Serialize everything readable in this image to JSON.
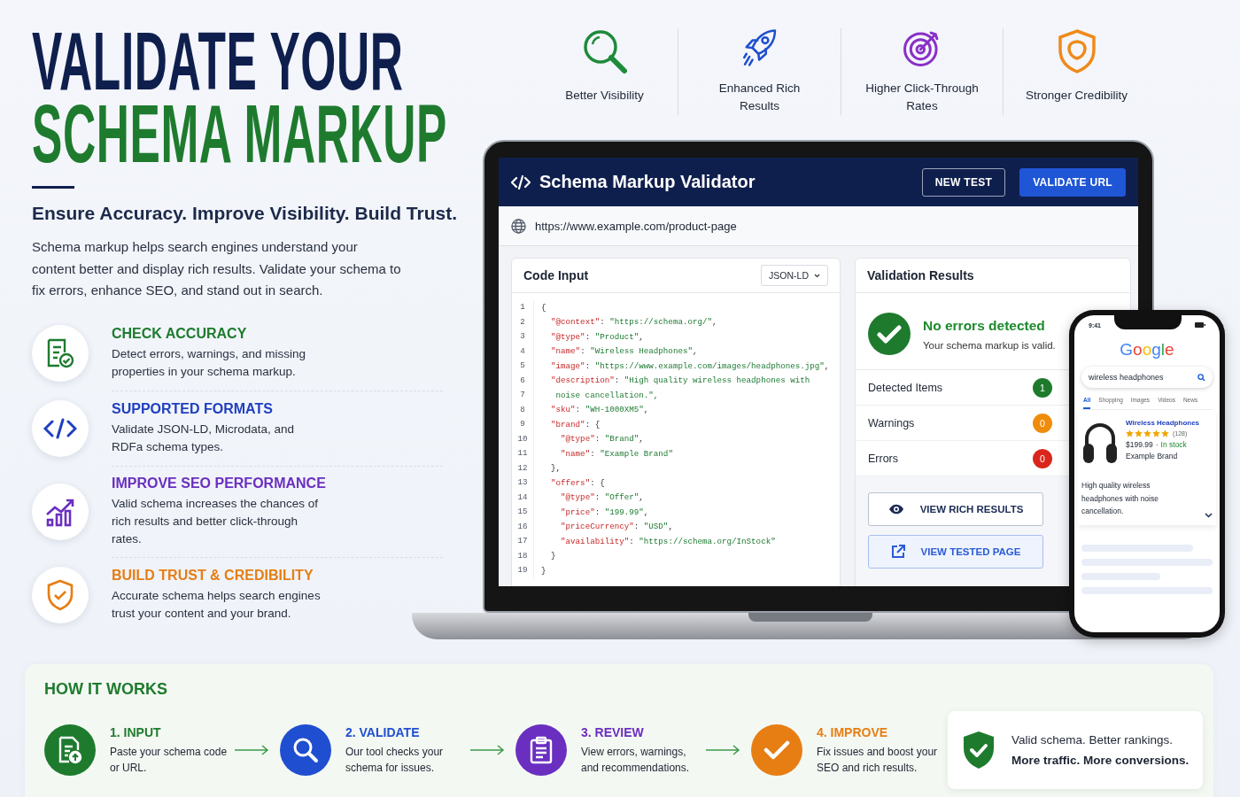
{
  "headline": {
    "line_1": "VALIDATE YOUR",
    "line_2": "SCHEMA MARKUP"
  },
  "tagline": "Ensure Accuracy. Improve Visibility. Build Trust.",
  "intro": "Schema markup helps search engines understand your content better and display rich results. Validate your schema to fix errors, enhance SEO, and stand out in search.",
  "features": [
    {
      "kind": "checklist",
      "title": "CHECK ACCURACY",
      "text": "Detect errors, warnings, and missing properties in your schema markup.",
      "color": "#1e7b2e"
    },
    {
      "kind": "code",
      "title": "SUPPORTED FORMATS",
      "text": "Validate JSON-LD, Microdata, and RDFa schema types.",
      "color": "#1f3fbf"
    },
    {
      "kind": "chart",
      "title": "IMPROVE SEO PERFORMANCE",
      "text": "Valid schema increases the chances of rich results and better click-through rates.",
      "color": "#6a2fc0"
    },
    {
      "kind": "shield",
      "title": "BUILD TRUST & CREDIBILITY",
      "text": "Accurate schema helps search engines trust your content and your brand.",
      "color": "#e67e14"
    }
  ],
  "benefits": [
    {
      "kind": "magnifier",
      "label": "Better Visibility"
    },
    {
      "kind": "rocket",
      "label": "Enhanced Rich Results"
    },
    {
      "kind": "target",
      "label": "Higher Click-Through Rates"
    },
    {
      "kind": "shield",
      "label": "Stronger Credibility"
    }
  ],
  "validator": {
    "title": "Schema Markup Validator",
    "buttons": [
      {
        "label": "NEW TEST",
        "kind": "outline"
      },
      {
        "label": "VALIDATE URL",
        "kind": "primary"
      }
    ],
    "url": "https://www.example.com/product-page",
    "code_panel": {
      "title": "Code Input",
      "format": "JSON-LD",
      "lines": [
        {
          "number": "1",
          "kind": "code",
          "text": "{"
        },
        {
          "number": "2",
          "kind": "code",
          "text": "  \"@context\": \"https://schema.org/\","
        },
        {
          "number": "3",
          "kind": "code",
          "text": "  \"@type\": \"Product\","
        },
        {
          "number": "4",
          "kind": "code",
          "text": "  \"name\": \"Wireless Headphones\","
        },
        {
          "number": "5",
          "kind": "code",
          "text": "  \"image\": \"https://www.example.com/images/headphones.jpg\","
        },
        {
          "number": "6",
          "kind": "code",
          "text": "  \"description\": \"High quality wireless headphones with"
        },
        {
          "number": "7",
          "kind": "continuation",
          "text": "   noise cancellation.\","
        },
        {
          "number": "8",
          "kind": "code",
          "text": "  \"sku\": \"WH-1000XM5\","
        },
        {
          "number": "9",
          "kind": "code",
          "text": "  \"brand\": {"
        },
        {
          "number": "10",
          "kind": "code",
          "text": "    \"@type\": \"Brand\","
        },
        {
          "number": "11",
          "kind": "code",
          "text": "    \"name\": \"Example Brand\""
        },
        {
          "number": "12",
          "kind": "code",
          "text": "  },"
        },
        {
          "number": "13",
          "kind": "code",
          "text": "  \"offers\": {"
        },
        {
          "number": "14",
          "kind": "code",
          "text": "    \"@type\": \"Offer\","
        },
        {
          "number": "15",
          "kind": "code",
          "text": "    \"price\": \"199.99\","
        },
        {
          "number": "16",
          "kind": "code",
          "text": "    \"priceCurrency\": \"USD\","
        },
        {
          "number": "17",
          "kind": "code",
          "text": "    \"availability\": \"https://schema.org/InStock\""
        },
        {
          "number": "18",
          "kind": "code",
          "text": "  }"
        },
        {
          "number": "19",
          "kind": "code",
          "text": "}"
        }
      ]
    },
    "results_panel": {
      "title": "Validation Results",
      "status_title": "No errors detected",
      "status_text": "Your schema markup is valid.",
      "counts": [
        {
          "label": "Detected Items",
          "count": "1",
          "color": "#1e7b2e"
        },
        {
          "label": "Warnings",
          "count": "0",
          "color": "#ef8c0c"
        },
        {
          "label": "Errors",
          "count": "0",
          "color": "#d9261c"
        }
      ],
      "actions": [
        {
          "kind": "eye",
          "label": "VIEW RICH RESULTS"
        },
        {
          "kind": "external",
          "label": "VIEW TESTED PAGE"
        }
      ]
    }
  },
  "phone": {
    "time": "9:41",
    "logo": "Google",
    "search": "wireless headphones",
    "tabs": [
      {
        "label": "All",
        "selected": true
      },
      {
        "label": "Shopping",
        "selected": false
      },
      {
        "label": "Images",
        "selected": false
      },
      {
        "label": "Videos",
        "selected": false
      },
      {
        "label": "News",
        "selected": false
      }
    ],
    "result": {
      "title": "Wireless Headphones",
      "stars": 5,
      "reviews": "(128)",
      "price": "$199.99",
      "separator": "·",
      "availability": "In stock",
      "brand": "Example Brand",
      "description": "High quality wireless headphones with noise cancellation."
    }
  },
  "how_it_works": {
    "title": "HOW IT WORKS",
    "steps": [
      {
        "kind": "upload",
        "title": "1. INPUT",
        "text": "Paste your schema code or URL.",
        "color": "#1e7b2e"
      },
      {
        "kind": "magnifier",
        "title": "2. VALIDATE",
        "text": "Our tool checks your schema for issues.",
        "color": "#1f4fd0"
      },
      {
        "kind": "clipboard",
        "title": "3. REVIEW",
        "text": "View errors, warnings, and recommendations.",
        "color": "#6a2fc0"
      },
      {
        "kind": "check",
        "title": "4. IMPROVE",
        "text": "Fix issues and boost your SEO and rich results.",
        "color": "#e67e14"
      }
    ],
    "summary": {
      "line_1": "Valid schema. Better rankings.",
      "line_2": "More traffic. More conversions."
    }
  }
}
